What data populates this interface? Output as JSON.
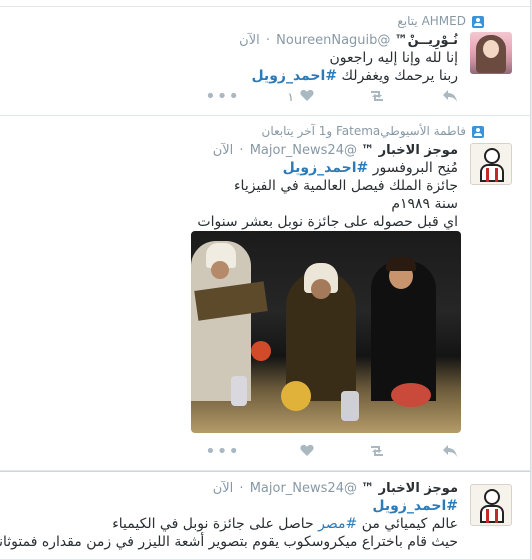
{
  "tweets": [
    {
      "context": "AHMED يتابع",
      "name": "نُـوْرِيــنْ™",
      "handle": "@NoureenNaguib",
      "time": "الآن",
      "lines": [
        "إنا لله وإنا إليه راجعون",
        "ربنا يرحمك ويغفرلك"
      ],
      "hashtag": "#احمد_زويل",
      "likes": "١"
    },
    {
      "context": "فاطمة الأسيوطيFatema و1 آخر يتابعان",
      "name": "موجز الاخبار ™",
      "handle": "@Major_News24",
      "time": "الآن",
      "line1_prefix": "مُنِح البروفسور",
      "hashtag": "#احمد_زويل",
      "lines": [
        "جائزة الملك فيصل العالمية في الفيزياء",
        "سنة ١٩٨٩م",
        "اي قبل حصوله على جائزة نوبل بعشر سنوات"
      ]
    },
    {
      "name": "موجز الاخبار ™",
      "handle": "@Major_News24",
      "time": "الآن",
      "hashtag": "#احمد_زويل",
      "line2_prefix": "عالم كيميائي من",
      "line2_link": "#مصر",
      "line2_suffix": "حاصل على جائزة نوبل في الكيمياء",
      "line3": "حيث قام باختراع ميكروسكوب يقوم بتصوير أشعة الليزر في زمن مقداره فمتوثانية"
    }
  ],
  "icons": {
    "reply": "reply-icon",
    "retweet": "retweet-icon",
    "like": "heart-icon",
    "more": "more-icon",
    "context": "person-icon"
  },
  "colors": {
    "link": "#2b7bb9",
    "muted": "#8899a6",
    "icon": "#aab8c2",
    "accent": "#3b94d9"
  }
}
